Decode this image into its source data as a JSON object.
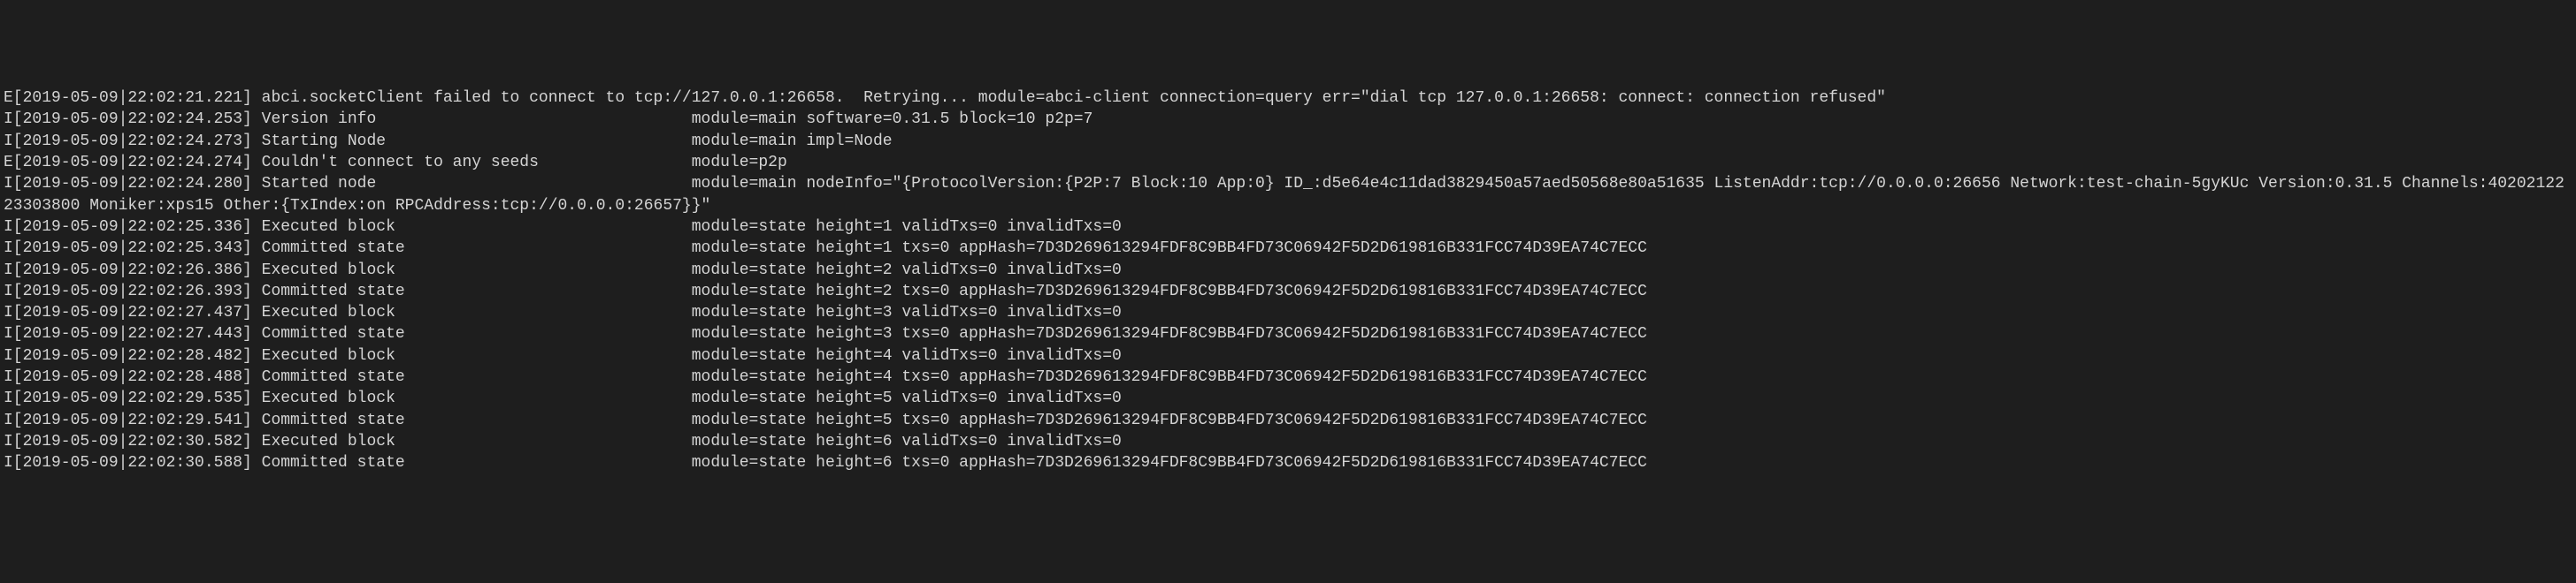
{
  "lines": [
    "E[2019-05-09|22:02:21.221] abci.socketClient failed to connect to tcp://127.0.0.1:26658.  Retrying... module=abci-client connection=query err=\"dial tcp 127.0.0.1:26658: connect: connection refused\"",
    "I[2019-05-09|22:02:24.253] Version info                                 module=main software=0.31.5 block=10 p2p=7",
    "I[2019-05-09|22:02:24.273] Starting Node                                module=main impl=Node",
    "E[2019-05-09|22:02:24.274] Couldn't connect to any seeds                module=p2p",
    "I[2019-05-09|22:02:24.280] Started node                                 module=main nodeInfo=\"{ProtocolVersion:{P2P:7 Block:10 App:0} ID_:d5e64e4c11dad3829450a57aed50568e80a51635 ListenAddr:tcp://0.0.0.0:26656 Network:test-chain-5gyKUc Version:0.31.5 Channels:4020212223303800 Moniker:xps15 Other:{TxIndex:on RPCAddress:tcp://0.0.0.0:26657}}\"",
    "I[2019-05-09|22:02:25.336] Executed block                               module=state height=1 validTxs=0 invalidTxs=0",
    "I[2019-05-09|22:02:25.343] Committed state                              module=state height=1 txs=0 appHash=7D3D269613294FDF8C9BB4FD73C06942F5D2D619816B331FCC74D39EA74C7ECC",
    "I[2019-05-09|22:02:26.386] Executed block                               module=state height=2 validTxs=0 invalidTxs=0",
    "I[2019-05-09|22:02:26.393] Committed state                              module=state height=2 txs=0 appHash=7D3D269613294FDF8C9BB4FD73C06942F5D2D619816B331FCC74D39EA74C7ECC",
    "I[2019-05-09|22:02:27.437] Executed block                               module=state height=3 validTxs=0 invalidTxs=0",
    "I[2019-05-09|22:02:27.443] Committed state                              module=state height=3 txs=0 appHash=7D3D269613294FDF8C9BB4FD73C06942F5D2D619816B331FCC74D39EA74C7ECC",
    "I[2019-05-09|22:02:28.482] Executed block                               module=state height=4 validTxs=0 invalidTxs=0",
    "I[2019-05-09|22:02:28.488] Committed state                              module=state height=4 txs=0 appHash=7D3D269613294FDF8C9BB4FD73C06942F5D2D619816B331FCC74D39EA74C7ECC",
    "I[2019-05-09|22:02:29.535] Executed block                               module=state height=5 validTxs=0 invalidTxs=0",
    "I[2019-05-09|22:02:29.541] Committed state                              module=state height=5 txs=0 appHash=7D3D269613294FDF8C9BB4FD73C06942F5D2D619816B331FCC74D39EA74C7ECC",
    "I[2019-05-09|22:02:30.582] Executed block                               module=state height=6 validTxs=0 invalidTxs=0",
    "I[2019-05-09|22:02:30.588] Committed state                              module=state height=6 txs=0 appHash=7D3D269613294FDF8C9BB4FD73C06942F5D2D619816B331FCC74D39EA74C7ECC"
  ]
}
